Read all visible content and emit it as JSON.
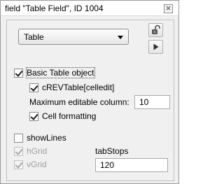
{
  "window": {
    "title": "field \"Table Field\", ID 1004",
    "close_glyph": "×"
  },
  "selector": {
    "value": "Table",
    "icon": "chevron-down-icon"
  },
  "side_buttons": {
    "lock_icon": "lock-open-icon",
    "play_icon": "play-icon"
  },
  "options": {
    "basic_table_object": {
      "label": "Basic Table object",
      "checked": true
    },
    "crev_table": {
      "label": "cREVTable[celledit]",
      "checked": true
    },
    "max_editable_column": {
      "label": "Maximum editable column:",
      "value": "10"
    },
    "cell_formatting": {
      "label": "Cell formatting",
      "checked": true
    },
    "show_lines": {
      "label": "showLines",
      "checked": false
    },
    "hgrid": {
      "label": "hGrid",
      "checked": true,
      "enabled": false
    },
    "vgrid": {
      "label": "vGrid",
      "checked": true,
      "enabled": false
    },
    "tab_stops": {
      "label": "tabStops",
      "value": "120"
    }
  }
}
